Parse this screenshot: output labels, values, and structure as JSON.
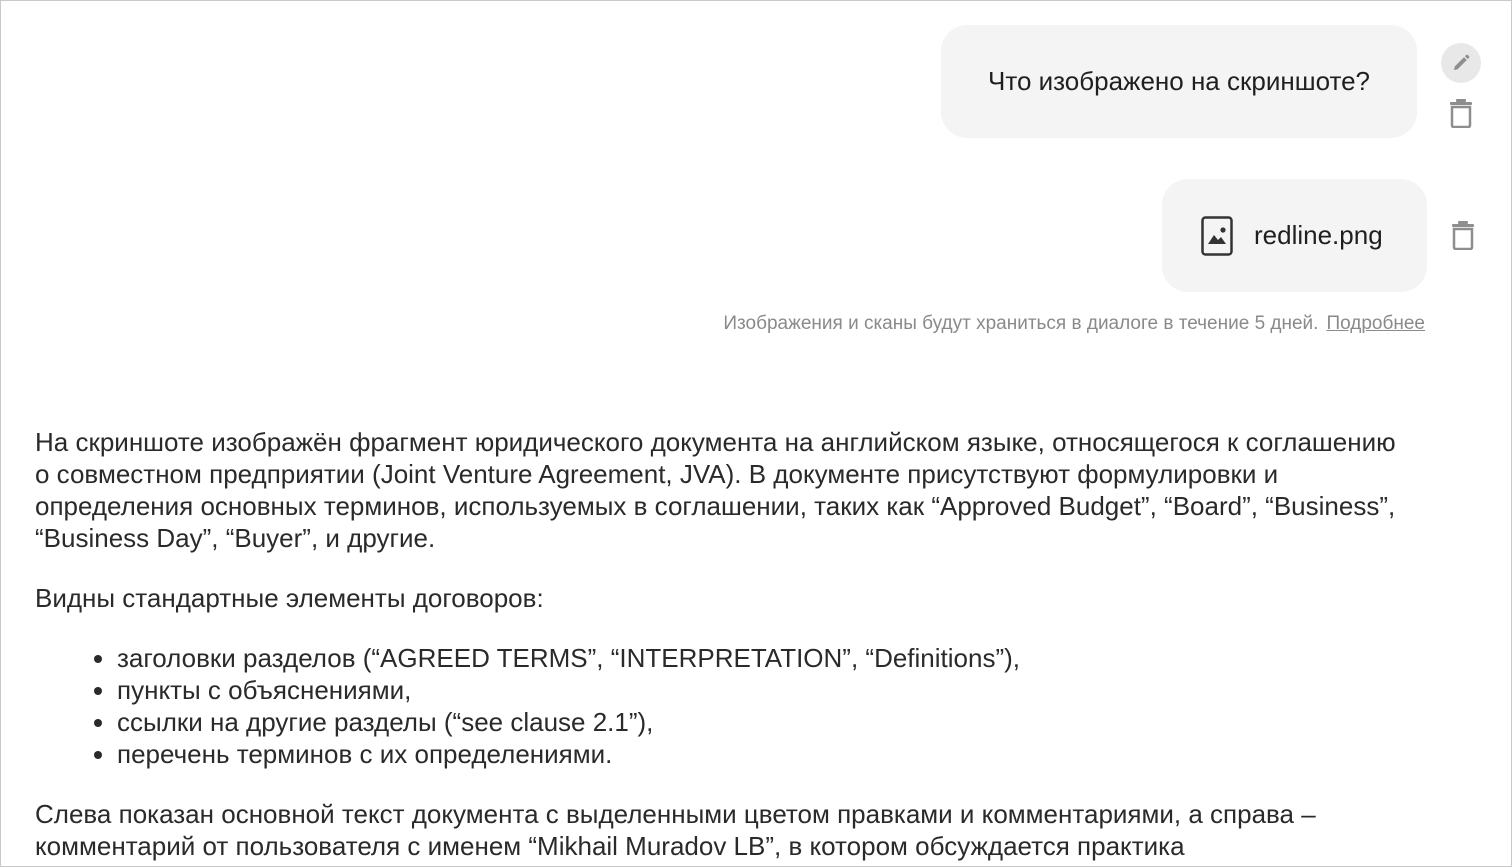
{
  "chat": {
    "user_question": "Что изображено на скриншоте?",
    "attachment": {
      "file_name": "redline.png",
      "icon": "image-file-icon"
    },
    "notice": {
      "text": "Изображения и сканы будут храниться в диалоге в течение 5 дней.",
      "link": "Подробнее"
    }
  },
  "answer": {
    "paragraph_1": "На скриншоте изображён фрагмент юридического документа на английском языке, относящегося к соглашению о совместном предприятии (Joint Venture Agreement, JVA). В документе присутствуют формулировки и определения основных терминов, используемых в соглашении, таких как “Approved Budget”, “Board”, “Business”, “Business Day”, “Buyer”, и другие.",
    "paragraph_2": "Видны стандартные элементы договоров:",
    "bullets": [
      "заголовки разделов (“AGREED TERMS”, “INTERPRETATION”, “Definitions”),",
      "пункты с объяснениями,",
      "ссылки на другие разделы (“see clause 2.1”),",
      "перечень терминов с их определениями."
    ],
    "paragraph_3": "Слева показан основной текст документа с выделенными цветом правками и комментариями, а справа – комментарий от пользователя с именем “Mikhail Muradov LB”, в котором обсуждается практика"
  },
  "colors": {
    "bubble_bg": "#f4f4f4",
    "muted_text": "#8a8a8a",
    "icon_gray": "#8e8e8e"
  }
}
